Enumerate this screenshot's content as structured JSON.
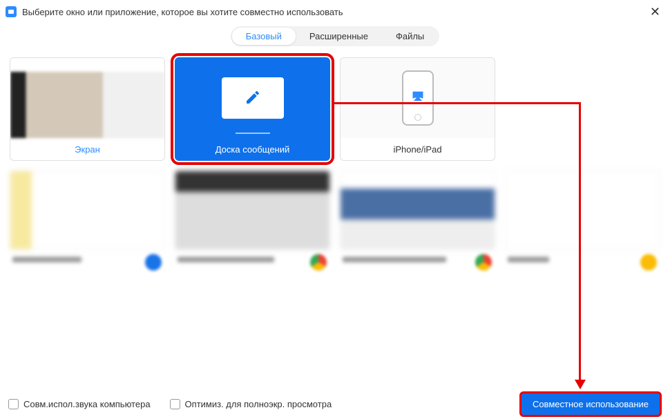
{
  "header": {
    "title": "Выберите окно или приложение, которое вы хотите совместно использовать"
  },
  "tabs": {
    "items": [
      {
        "label": "Базовый",
        "active": true
      },
      {
        "label": "Расширенные",
        "active": false
      },
      {
        "label": "Файлы",
        "active": false
      }
    ]
  },
  "options": {
    "screen": {
      "label": "Экран"
    },
    "whiteboard": {
      "label": "Доска сообщений"
    },
    "iphone": {
      "label": "iPhone/iPad"
    }
  },
  "footer": {
    "shareAudio": "Совм.испол.звука компьютера",
    "optimizeVideo": "Оптимиз. для полноэкр. просмотра",
    "shareButton": "Совместное использование"
  },
  "colors": {
    "accent": "#0e71eb",
    "highlight": "#e60000"
  }
}
